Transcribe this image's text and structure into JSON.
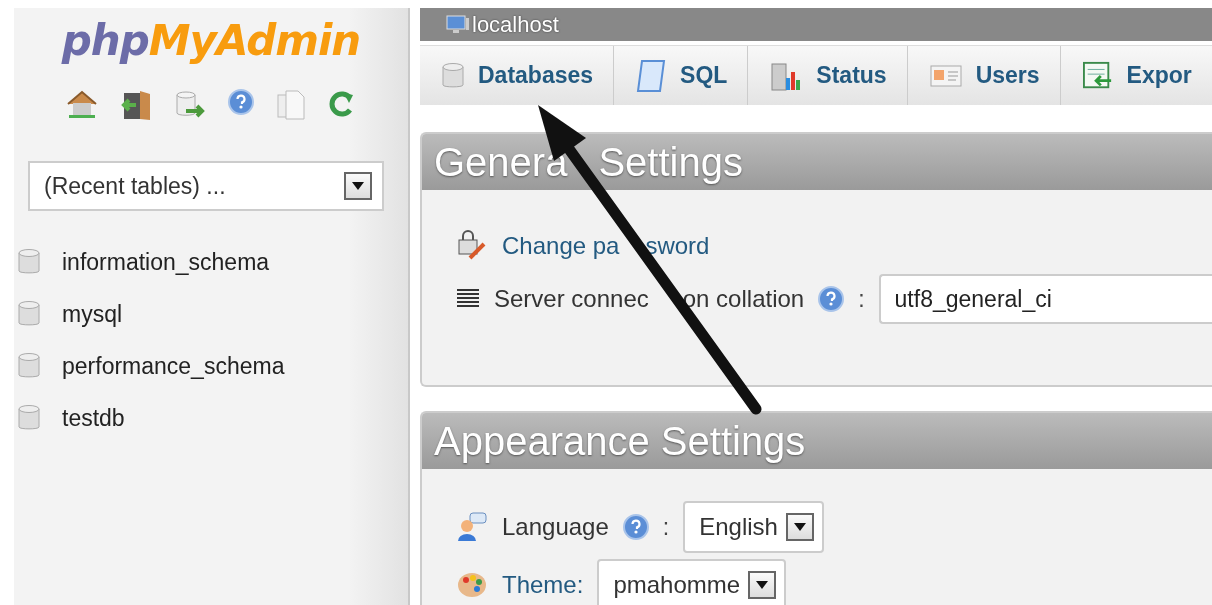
{
  "logo": {
    "part_1": "php",
    "part_2": "MyAdmin"
  },
  "sidebar": {
    "recent_tables": {
      "value": "(Recent tables) ..."
    },
    "databases": [
      {
        "name": "information_schema"
      },
      {
        "name": "mysql"
      },
      {
        "name": "performance_schema"
      },
      {
        "name": "testdb"
      }
    ]
  },
  "breadcrumb": "localhost",
  "tabs": [
    {
      "label": "Databases",
      "kind": "database",
      "selected": false
    },
    {
      "label": "SQL",
      "kind": "sql",
      "selected": false
    },
    {
      "label": "Status",
      "kind": "status",
      "selected": false
    },
    {
      "label": "Users",
      "kind": "users",
      "selected": false
    },
    {
      "label": "Expor",
      "kind": "export",
      "selected": false
    }
  ],
  "general_settings": {
    "title_parts": [
      "Genera",
      "Settings"
    ],
    "change_password_parts": [
      "Change pa",
      "sword"
    ],
    "collation": {
      "label_parts": [
        "Server connec",
        "on collation"
      ],
      "colon": ":",
      "value": "utf8_general_ci"
    }
  },
  "appearance_settings": {
    "title": "Appearance Settings",
    "language": {
      "label": "Language",
      "colon": ":",
      "value": "English"
    },
    "theme": {
      "label": "Theme:",
      "value": "pmahomme"
    }
  }
}
